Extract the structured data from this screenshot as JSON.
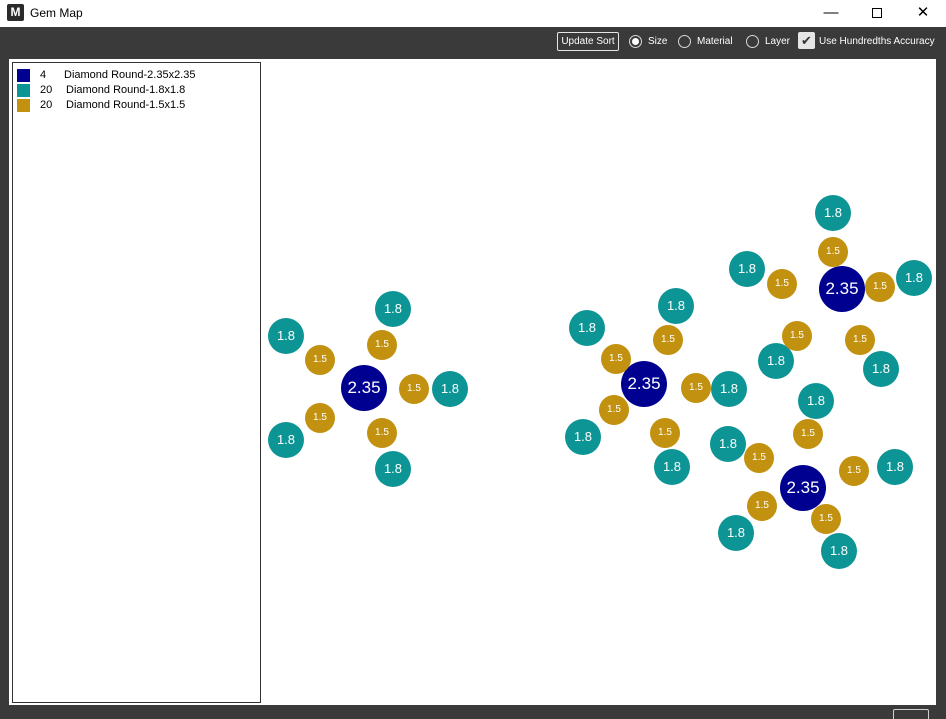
{
  "window": {
    "title": "Gem Map",
    "logo_letter": "M",
    "minimize_glyph": "—",
    "close_glyph": "✕"
  },
  "toolbar": {
    "update_label": "Update Sort",
    "sort_options": [
      {
        "label": "Size",
        "checked": true
      },
      {
        "label": "Material",
        "checked": false
      },
      {
        "label": "Layer",
        "checked": false
      }
    ],
    "accuracy_label": "Use Hundredths Accuracy",
    "accuracy_checked": true,
    "check_glyph": "✔"
  },
  "colors": {
    "d235": "#000090",
    "d18": "#0d9494",
    "d15": "#c2910f"
  },
  "legend": [
    {
      "count": "4",
      "name": "Diamond Round-2.35x2.35",
      "color_key": "d235"
    },
    {
      "count": "20",
      "name": "Diamond Round-1.8x1.8",
      "color_key": "d18"
    },
    {
      "count": "20",
      "name": "Diamond Round-1.5x1.5",
      "color_key": "d15"
    }
  ],
  "gem_labels": {
    "d235": "2.35",
    "d18": "1.8",
    "d15": "1.5"
  }
}
